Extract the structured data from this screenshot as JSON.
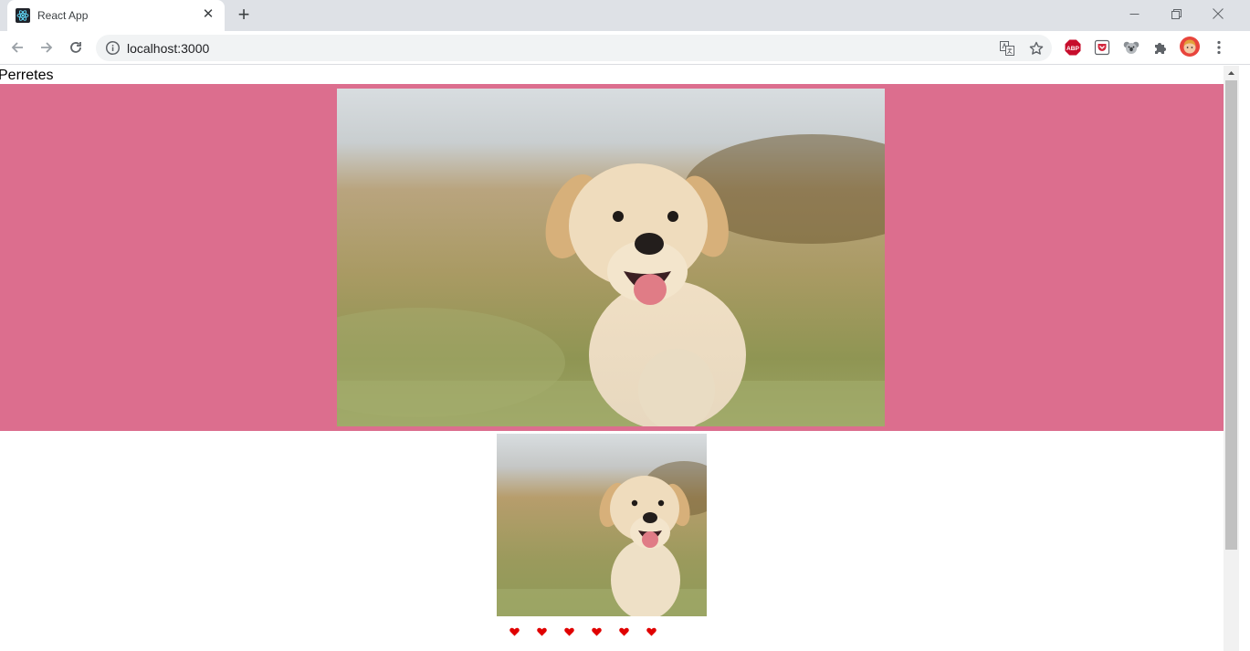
{
  "browser": {
    "tab_title": "React App",
    "url": "localhost:3000",
    "icons": [
      "react-favicon",
      "close-icon",
      "plus-icon",
      "back-icon",
      "forward-icon",
      "reload-icon",
      "info-icon",
      "translate-icon",
      "star-icon",
      "adblock-icon",
      "pocket-icon",
      "koala-icon",
      "puzzle-icon",
      "avatar",
      "kebab-menu-icon"
    ],
    "extensions": {
      "adblock_label": "ABP"
    }
  },
  "page": {
    "title": "Perretes",
    "hero_bg": "#dc6e8e",
    "like_count": 6,
    "heart_color": "#e00000"
  }
}
